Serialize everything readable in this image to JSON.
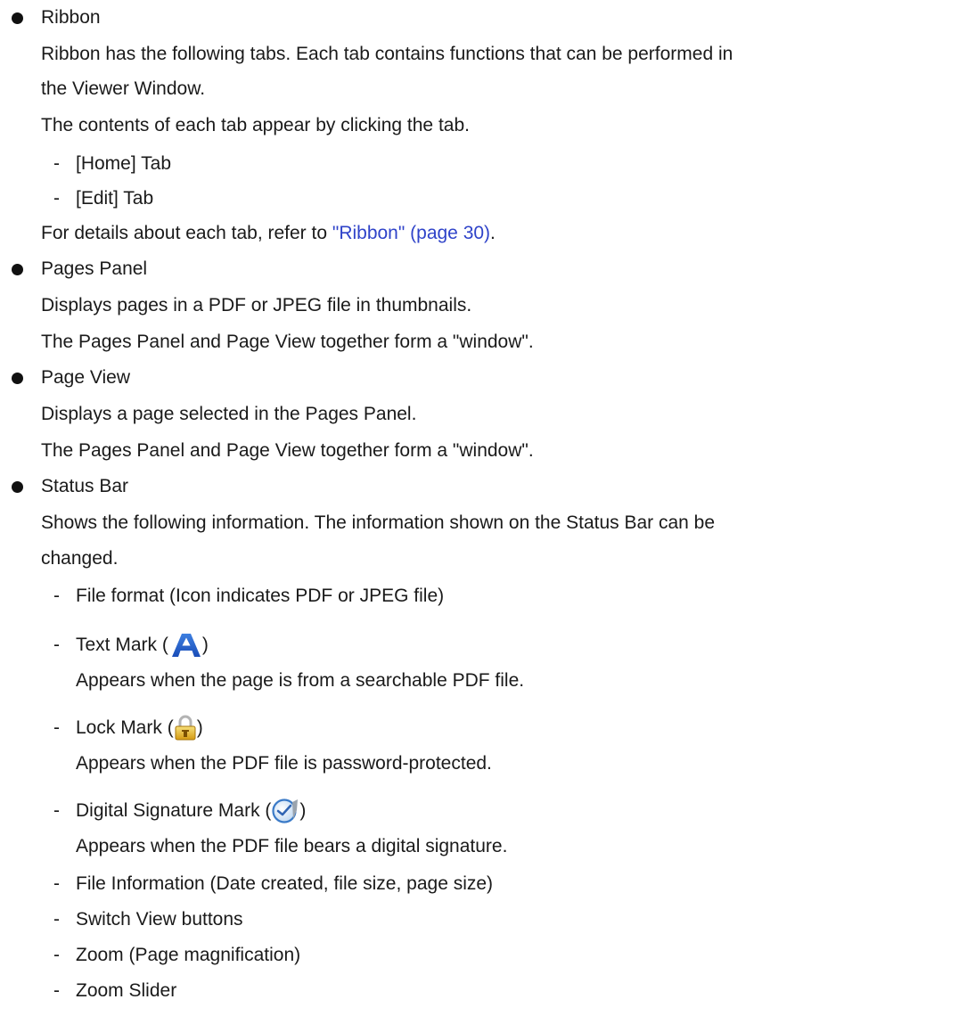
{
  "sections": {
    "ribbon": {
      "title": "Ribbon",
      "desc1": "Ribbon has the following tabs. Each tab contains functions that can be performed in",
      "desc2": "the Viewer Window.",
      "desc3": "The contents of each tab appear by clicking the tab.",
      "items": [
        "[Home] Tab",
        "[Edit] Tab"
      ],
      "ref_prefix": "For details about each tab, refer to ",
      "ref_link": "\"Ribbon\" (page 30)",
      "ref_suffix": "."
    },
    "pages_panel": {
      "title": "Pages Panel",
      "desc1": "Displays pages in a PDF or JPEG file in thumbnails.",
      "desc2": "The Pages Panel and Page View together form a \"window\"."
    },
    "page_view": {
      "title": "Page View",
      "desc1": "Displays a page selected in the Pages Panel.",
      "desc2": "The Pages Panel and Page View together form a \"window\"."
    },
    "status_bar": {
      "title": "Status Bar",
      "desc1": "Shows the following information. The information shown on the Status Bar can be",
      "desc2": "changed.",
      "file_format": "File format (Icon indicates PDF or JPEG file)",
      "text_mark_label": "Text Mark (",
      "text_mark_desc": "Appears when the page is from a searchable PDF file.",
      "lock_mark_label": "Lock Mark (",
      "lock_mark_desc": "Appears when the PDF file is password-protected.",
      "sig_mark_label": "Digital Signature Mark (",
      "sig_mark_desc": "Appears when the PDF file bears a digital signature.",
      "close_paren": ")",
      "file_info": "File Information (Date created, file size, page size)",
      "switch_view": "Switch View buttons",
      "zoom": "Zoom (Page magnification)",
      "zoom_slider": "Zoom Slider"
    }
  },
  "dash": "-",
  "icons": {
    "text_mark": "text-mark-icon",
    "lock_mark": "lock-icon",
    "digital_signature": "digital-signature-icon"
  },
  "colors": {
    "link": "#2f43c9"
  }
}
